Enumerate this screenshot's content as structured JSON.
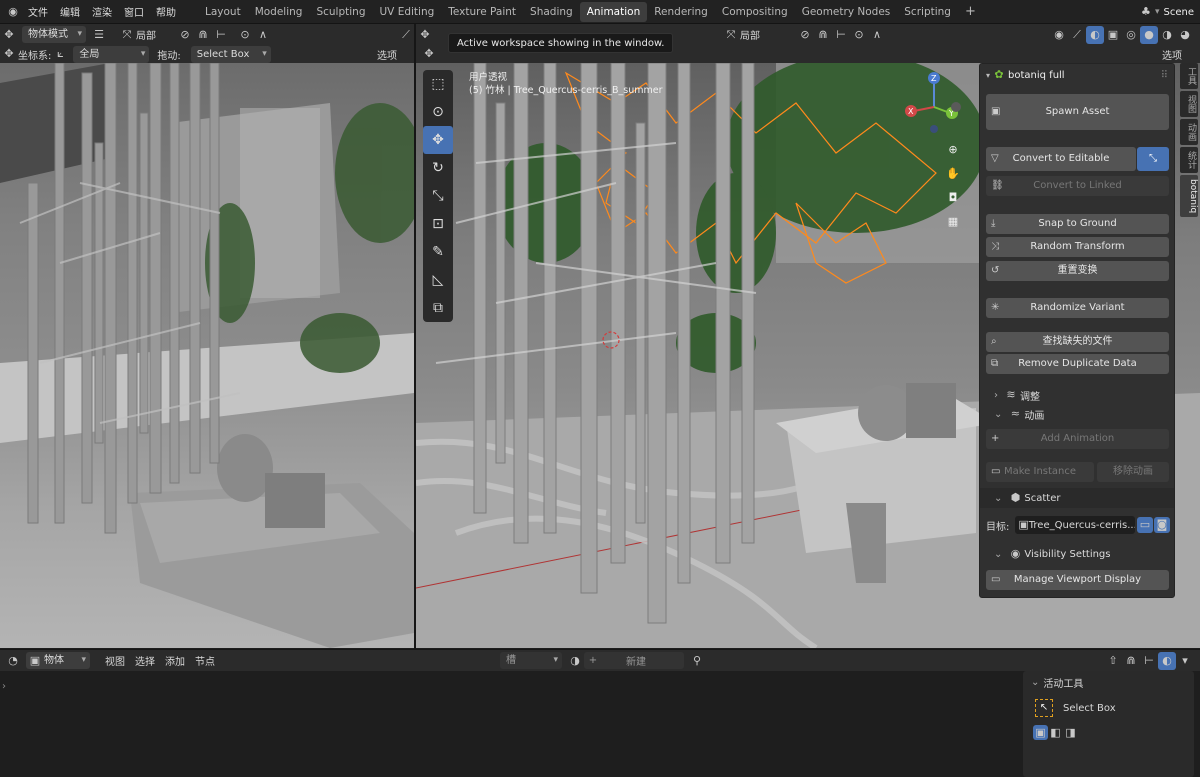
{
  "menus": [
    "文件",
    "编辑",
    "渲染",
    "窗口",
    "帮助"
  ],
  "workspaces": [
    "Layout",
    "Modeling",
    "Sculpting",
    "UV Editing",
    "Texture Paint",
    "Shading",
    "Animation",
    "Rendering",
    "Compositing",
    "Geometry Nodes",
    "Scripting"
  ],
  "active_workspace": "Animation",
  "scene_name": "Scene",
  "left_viewport": {
    "mode": "物体模式",
    "orientation": "局部",
    "coord_label": "坐标系:",
    "coord_value": "全局",
    "drag_label": "拖动:",
    "drag_value": "Select Box",
    "options": "选项"
  },
  "right_viewport": {
    "orientation": "局部",
    "options": "选项",
    "view_name": "用户透视",
    "object_info": "(5) 竹林 | Tree_Quercus-cerris_B_summer",
    "drag_value": "Select Box",
    "menu_partial": "物体"
  },
  "tooltip": "Active workspace showing in the window.",
  "botaniq": {
    "title": "botaniq full",
    "spawn": "Spawn Asset",
    "convert_editable": "Convert to Editable",
    "convert_linked": "Convert to Linked",
    "snap": "Snap to Ground",
    "random_transform": "Random Transform",
    "reset_transform": "重置变换",
    "randomize_variant": "Randomize Variant",
    "find_missing": "查找缺失的文件",
    "remove_duplicate": "Remove Duplicate Data",
    "adjust": "调整",
    "animation": "动画",
    "add_animation": "Add Animation",
    "make_instance": "Make Instance",
    "remove_animation": "移除动画",
    "scatter": "Scatter",
    "target_label": "目标:",
    "target_value": "Tree_Quercus-cerris...",
    "visibility": "Visibility Settings",
    "manage_display": "Manage Viewport Display"
  },
  "side_tabs": [
    "工具",
    "视图",
    "动画",
    "统计",
    "botaniq"
  ],
  "timeline": {
    "mode": "物体",
    "menus": [
      "视图",
      "选择",
      "添加",
      "节点"
    ],
    "slot": "槽",
    "new": "新建"
  },
  "active_tool": {
    "title": "活动工具",
    "tool": "Select Box"
  }
}
